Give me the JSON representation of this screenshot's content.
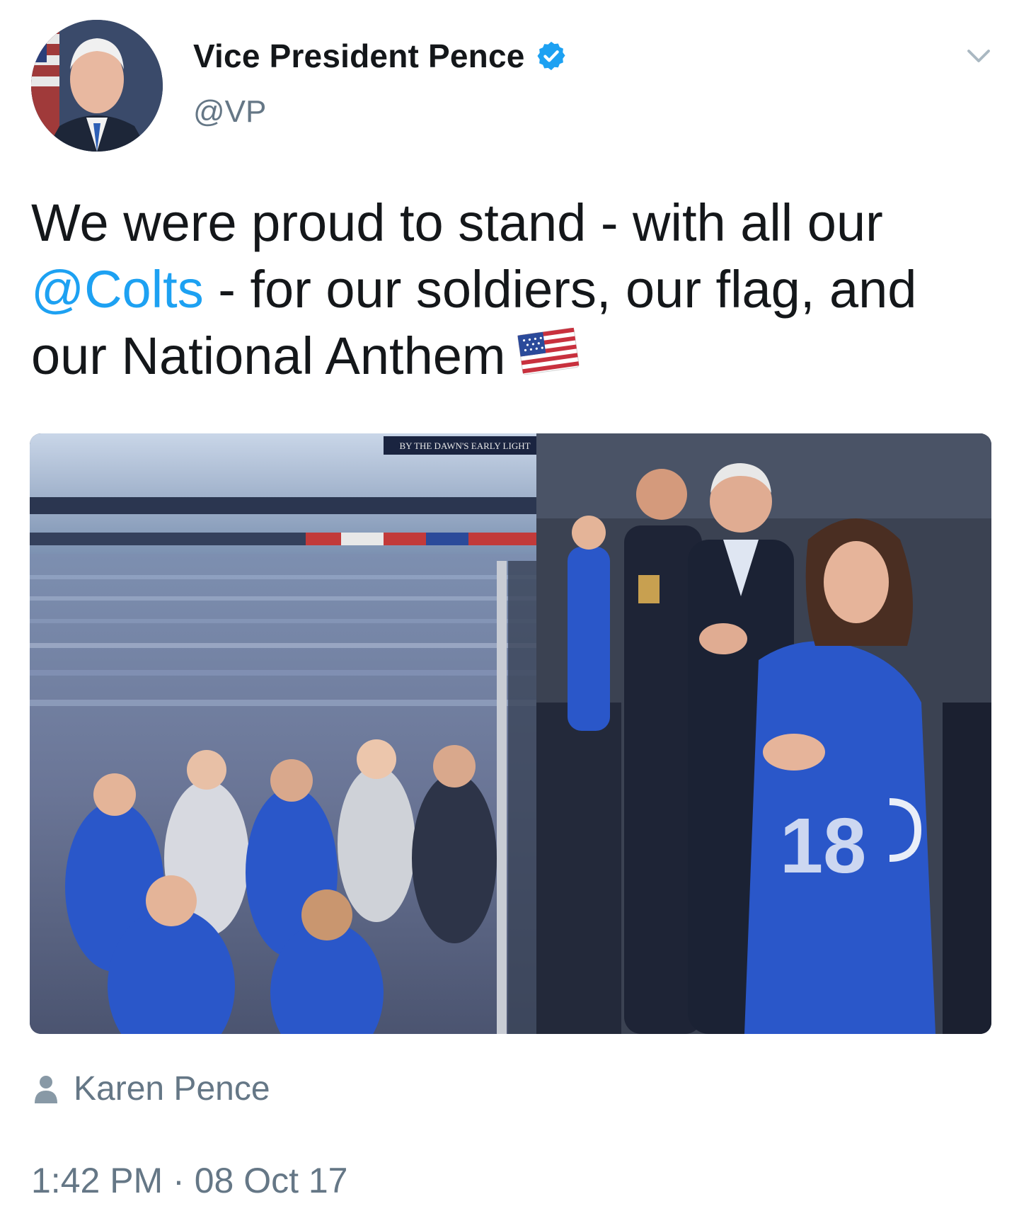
{
  "author": {
    "display_name": "Vice President Pence",
    "handle": "@VP",
    "verified": true,
    "avatar_icon": "profile-photo"
  },
  "tweet": {
    "text_before": "We were proud to stand - with all our ",
    "mention": "@Colts",
    "text_after": " - for our soldiers, our flag, and our National Anthem",
    "emoji": "us-flag-emoji"
  },
  "media": {
    "banner_text": "BY THE DAWN'S EARLY LIGHT"
  },
  "tagged_user": {
    "icon": "person-icon",
    "name": "Karen Pence"
  },
  "timestamp": {
    "time": "1:42 PM",
    "separator": "·",
    "date": "08 Oct 17"
  },
  "colors": {
    "link": "#1da1f2",
    "secondary_text": "#657786",
    "primary_text": "#14171a",
    "verified_badge": "#1da1f2",
    "jersey_blue": "#2a57c9"
  }
}
